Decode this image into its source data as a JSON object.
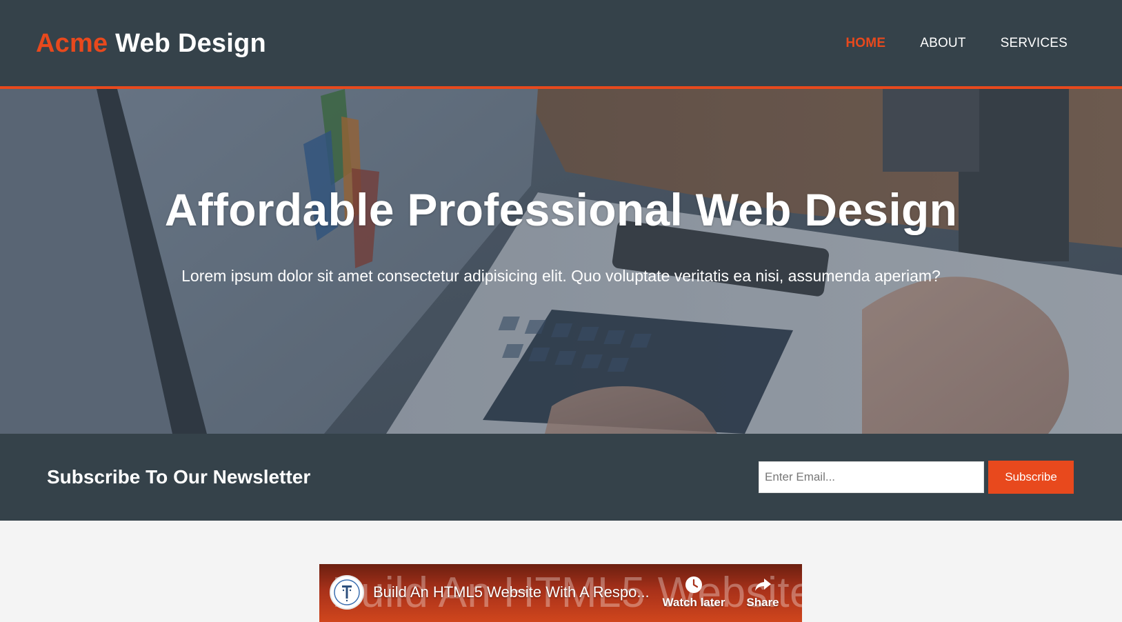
{
  "header": {
    "brand_highlight": "Acme",
    "brand_rest": "Web Design",
    "nav": [
      {
        "label": "HOME",
        "current": true
      },
      {
        "label": "ABOUT",
        "current": false
      },
      {
        "label": "SERVICES",
        "current": false
      }
    ]
  },
  "showcase": {
    "title": "Affordable Professional Web Design",
    "text": "Lorem ipsum dolor sit amet consectetur adipisicing elit. Quo voluptate veritatis ea nisi, assumenda aperiam?"
  },
  "newsletter": {
    "heading": "Subscribe To Our Newsletter",
    "email_placeholder": "Enter Email...",
    "button_label": "Subscribe"
  },
  "video": {
    "title": "Build An HTML5 Website With A Respo...",
    "background_text": "Build An HTML5 Website",
    "watch_later_label": "Watch later",
    "share_label": "Share"
  },
  "colors": {
    "accent": "#e8491d",
    "dark": "#35424a",
    "page_bg": "#f4f4f4"
  },
  "icons": [
    "channel-logo-icon",
    "clock-icon",
    "share-arrow-icon"
  ]
}
